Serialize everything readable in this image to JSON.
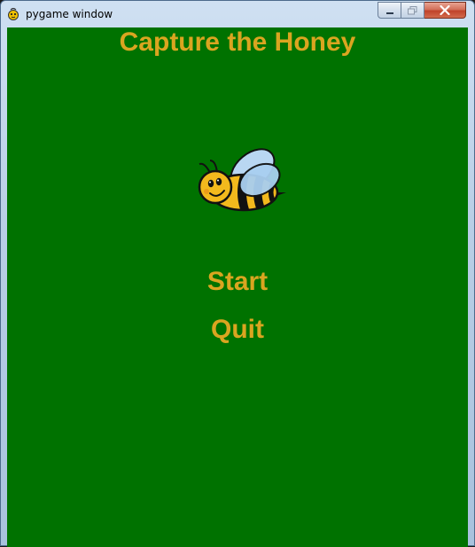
{
  "window": {
    "title": "pygame window",
    "icon": "pygame-snake-icon",
    "controls": {
      "minimize_icon": "minimize-icon",
      "maximize_icon": "maximize-icon",
      "close_icon": "close-icon"
    }
  },
  "game": {
    "background_color": "#007200",
    "text_color": "#daa520",
    "title": "Capture the Honey",
    "mascot": "bee-icon",
    "menu": [
      {
        "label": "Start"
      },
      {
        "label": "Quit"
      }
    ]
  }
}
